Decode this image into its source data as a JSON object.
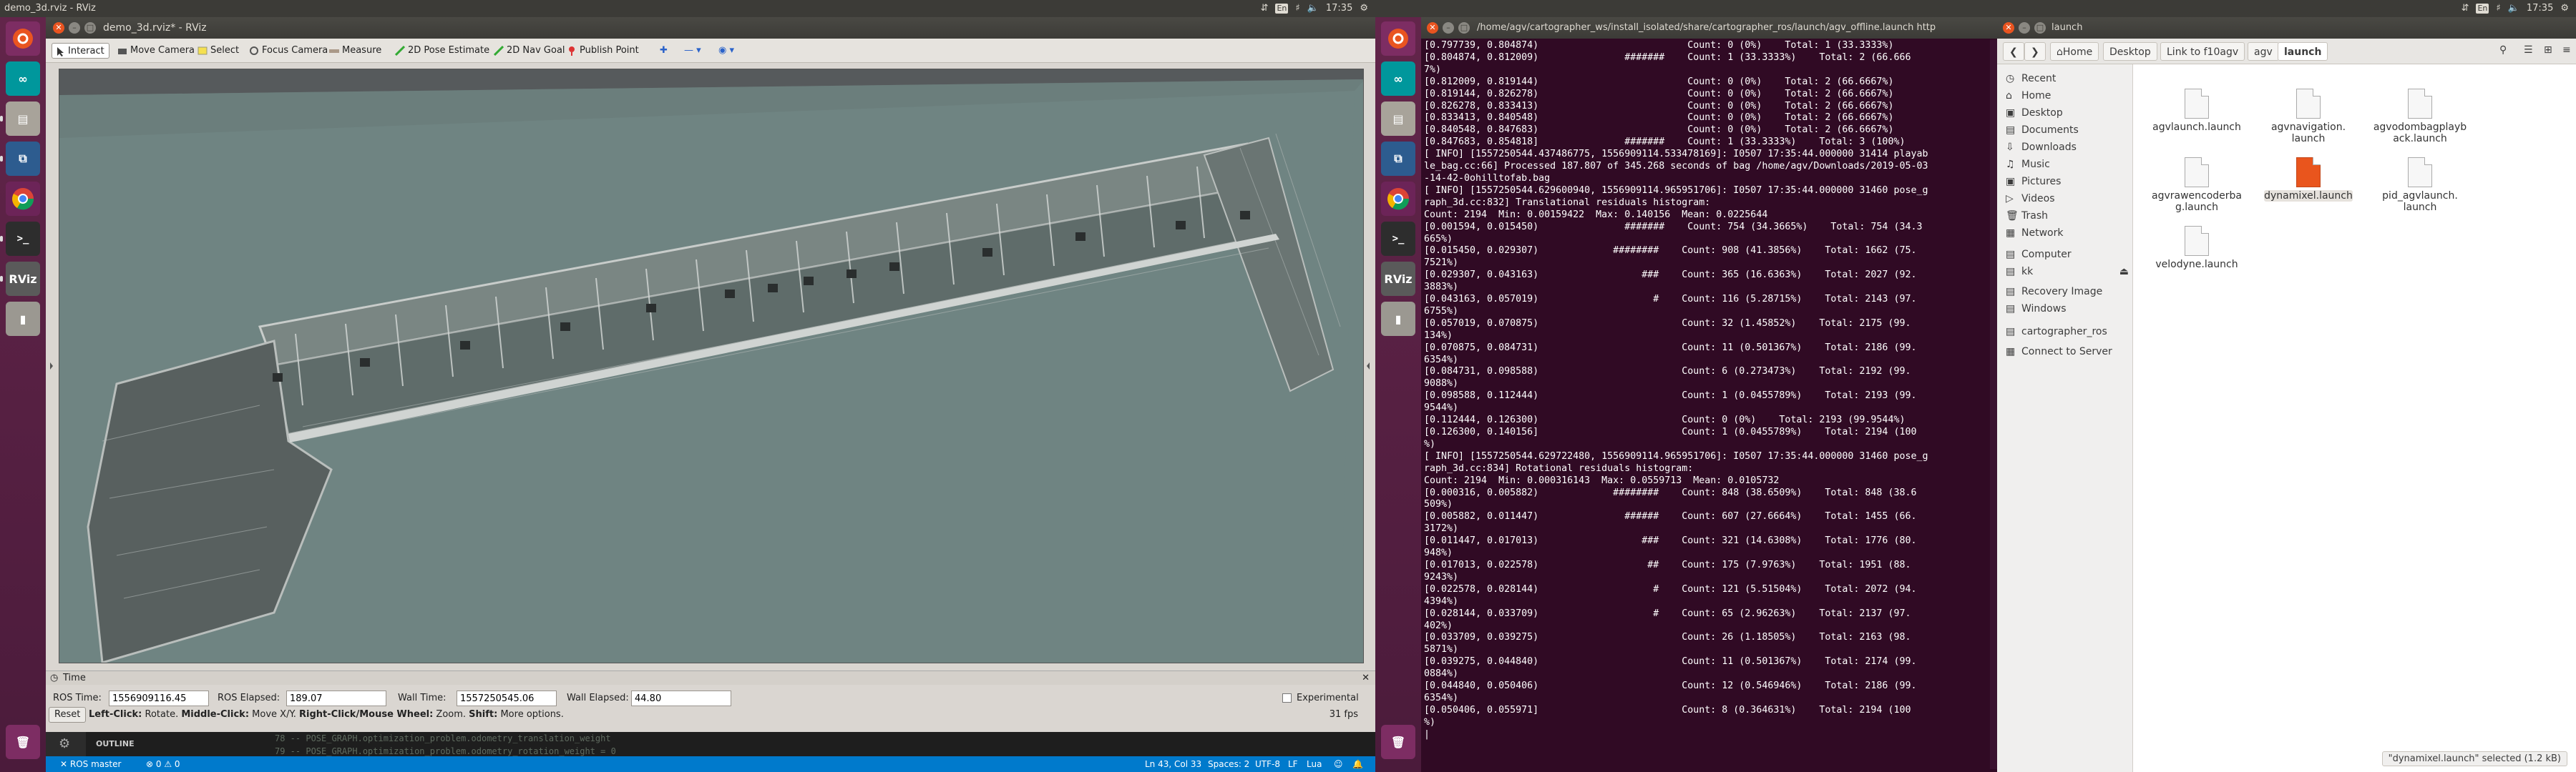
{
  "left_topbar": {
    "title": "demo_3d.rviz - RViz",
    "time": "17:35",
    "kbd": "En"
  },
  "right_topbar": {
    "time": "17:35",
    "kbd": "En"
  },
  "rviz": {
    "window_title": "demo_3d.rviz* - RViz",
    "tools": [
      "Interact",
      "Move Camera",
      "Select",
      "Focus Camera",
      "Measure",
      "2D Pose Estimate",
      "2D Nav Goal",
      "Publish Point"
    ],
    "time_panel_title": "Time",
    "ros_time_label": "ROS Time:",
    "ros_time": "1556909116.45",
    "ros_elapsed_label": "ROS Elapsed:",
    "ros_elapsed": "189.07",
    "wall_time_label": "Wall Time:",
    "wall_time": "1557250545.06",
    "wall_elapsed_label": "Wall Elapsed:",
    "wall_elapsed": "44.80",
    "experimental": "Experimental",
    "reset": "Reset",
    "hint_left": "Left-Click:",
    "hint_left_t": " Rotate. ",
    "hint_mid": "Middle-Click:",
    "hint_mid_t": " Move X/Y. ",
    "hint_right": "Right-Click/Mouse Wheel:",
    "hint_right_t": " Zoom. ",
    "hint_shift": "Shift:",
    "hint_shift_t": " More options.",
    "fps": "31 fps"
  },
  "vscode": {
    "outline": "OUTLINE",
    "line1": "78   -- POSE_GRAPH.optimization_problem.odometry_translation_weight",
    "line2": "79   -- POSE_GRAPH.optimization_problem.odometry_rotation_weight = 0",
    "ros_master": "ROS master",
    "problems": "⊗ 0 ⚠ 0",
    "position": "Ln 43, Col 33",
    "spaces": "Spaces: 2",
    "encoding": "UTF-8",
    "eol": "LF",
    "lang": "Lua"
  },
  "terminal": {
    "title": "/home/agv/cartographer_ws/install_isolated/share/cartographer_ros/launch/agv_offline.launch http",
    "lines": [
      "[0.797739, 0.804874)                          Count: 0 (0%)    Total: 1 (33.3333%)",
      "[0.804874, 0.812009)               #######    Count: 1 (33.3333%)    Total: 2 (66.666",
      "7%)",
      "[0.812009, 0.819144)                          Count: 0 (0%)    Total: 2 (66.6667%)",
      "[0.819144, 0.826278)                          Count: 0 (0%)    Total: 2 (66.6667%)",
      "[0.826278, 0.833413)                          Count: 0 (0%)    Total: 2 (66.6667%)",
      "[0.833413, 0.840548)                          Count: 0 (0%)    Total: 2 (66.6667%)",
      "[0.840548, 0.847683)                          Count: 0 (0%)    Total: 2 (66.6667%)",
      "[0.847683, 0.854818]               #######    Count: 1 (33.3333%)    Total: 3 (100%)",
      "[ INFO] [1557250544.437486775, 1556909114.533478169]: I0507 17:35:44.000000 31414 playab",
      "le_bag.cc:66] Processed 187.807 of 345.268 seconds of bag /home/agv/Downloads/2019-05-03",
      "-14-42-0ohilltofab.bag",
      "[ INFO] [1557250544.629600940, 1556909114.965951706]: I0507 17:35:44.000000 31460 pose_g",
      "raph_3d.cc:832] Translational residuals histogram:",
      "Count: 2194  Min: 0.00159422  Max: 0.140156  Mean: 0.0225644",
      "[0.001594, 0.015450)               #######    Count: 754 (34.3665%)    Total: 754 (34.3",
      "665%)",
      "[0.015450, 0.029307)             ########    Count: 908 (41.3856%)    Total: 1662 (75.",
      "7521%)",
      "[0.029307, 0.043163)                  ###    Count: 365 (16.6363%)    Total: 2027 (92.",
      "3883%)",
      "[0.043163, 0.057019)                    #    Count: 116 (5.28715%)    Total: 2143 (97.",
      "6755%)",
      "[0.057019, 0.070875)                         Count: 32 (1.45852%)    Total: 2175 (99.",
      "134%)",
      "[0.070875, 0.084731)                         Count: 11 (0.501367%)    Total: 2186 (99.",
      "6354%)",
      "[0.084731, 0.098588)                         Count: 6 (0.273473%)    Total: 2192 (99.",
      "9088%)",
      "[0.098588, 0.112444)                         Count: 1 (0.0455789%)    Total: 2193 (99.",
      "9544%)",
      "[0.112444, 0.126300)                         Count: 0 (0%)    Total: 2193 (99.9544%)",
      "[0.126300, 0.140156]                         Count: 1 (0.0455789%)    Total: 2194 (100",
      "%)",
      "[ INFO] [1557250544.629722480, 1556909114.965951706]: I0507 17:35:44.000000 31460 pose_g",
      "raph_3d.cc:834] Rotational residuals histogram:",
      "Count: 2194  Min: 0.000316143  Max: 0.0559713  Mean: 0.0105732",
      "[0.000316, 0.005882)             ########    Count: 848 (38.6509%)    Total: 848 (38.6",
      "509%)",
      "[0.005882, 0.011447)               ######    Count: 607 (27.6664%)    Total: 1455 (66.",
      "3172%)",
      "[0.011447, 0.017013)                  ###    Count: 321 (14.6308%)    Total: 1776 (80.",
      "948%)",
      "[0.017013, 0.022578)                   ##    Count: 175 (7.9763%)    Total: 1951 (88.",
      "9243%)",
      "[0.022578, 0.028144)                    #    Count: 121 (5.51504%)    Total: 2072 (94.",
      "4394%)",
      "[0.028144, 0.033709)                    #    Count: 65 (2.96263%)    Total: 2137 (97.",
      "402%)",
      "[0.033709, 0.039275)                         Count: 26 (1.18505%)    Total: 2163 (98.",
      "5871%)",
      "[0.039275, 0.044840)                         Count: 11 (0.501367%)    Total: 2174 (99.",
      "0884%)",
      "[0.044840, 0.050406)                         Count: 12 (0.546946%)    Total: 2186 (99.",
      "6354%)",
      "[0.050406, 0.055971]                         Count: 8 (0.364631%)    Total: 2194 (100",
      "%)",
      "|"
    ]
  },
  "files": {
    "title": "launch",
    "crumbs": [
      "Home",
      "Desktop",
      "Link to f10agv",
      "agv",
      "launch"
    ],
    "sidebar": [
      "Recent",
      "Home",
      "Desktop",
      "Documents",
      "Downloads",
      "Music",
      "Pictures",
      "Videos",
      "Trash",
      "Network",
      "Computer",
      "kk",
      "Recovery Image",
      "Windows",
      "cartographer_ros",
      "Connect to Server"
    ],
    "items": [
      {
        "name": "agvlaunch.launch"
      },
      {
        "name": "agvnavigation.\nlaunch"
      },
      {
        "name": "agvodombagplayb\nack.launch"
      },
      {
        "name": "agvrawencoderba\ng.launch"
      },
      {
        "name": "dynamixel.launch"
      },
      {
        "name": "pid_agvlaunch.\nlaunch"
      },
      {
        "name": "velodyne.launch"
      }
    ],
    "status": "\"dynamixel.launch\" selected  (1.2 kB)"
  },
  "colors": {
    "launcher": "#5e2750",
    "terminal_bg": "#300a24",
    "rviz_bg": "#6f8482",
    "selected_file": "#e9551d",
    "vscode_status": "#007acc"
  }
}
